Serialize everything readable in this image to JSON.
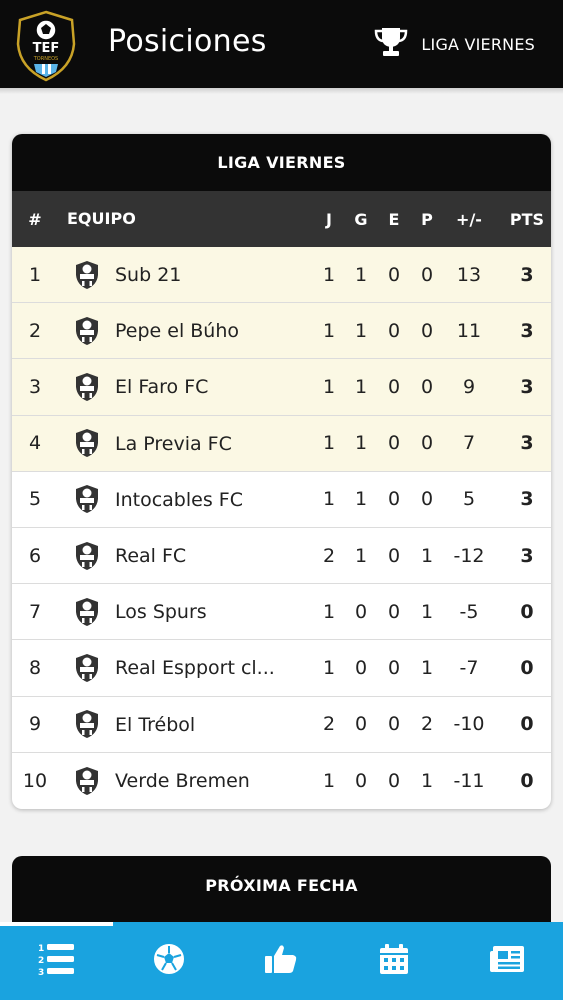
{
  "header": {
    "title": "Posiciones",
    "league_label": "LIGA VIERNES",
    "logo_text": "TEF",
    "logo_subtext": "TORNEOS"
  },
  "standings": {
    "title": "LIGA VIERNES",
    "columns": {
      "pos": "#",
      "team": "EQUIPO",
      "j": "J",
      "g": "G",
      "e": "E",
      "p": "P",
      "dif": "+/-",
      "pts": "PTS"
    },
    "rows": [
      {
        "pos": "1",
        "team": "Sub 21",
        "j": "1",
        "g": "1",
        "e": "0",
        "p": "0",
        "dif": "13",
        "pts": "3"
      },
      {
        "pos": "2",
        "team": "Pepe el Búho",
        "j": "1",
        "g": "1",
        "e": "0",
        "p": "0",
        "dif": "11",
        "pts": "3"
      },
      {
        "pos": "3",
        "team": "El Faro FC",
        "j": "1",
        "g": "1",
        "e": "0",
        "p": "0",
        "dif": "9",
        "pts": "3"
      },
      {
        "pos": "4",
        "team": "La Previa FC",
        "j": "1",
        "g": "1",
        "e": "0",
        "p": "0",
        "dif": "7",
        "pts": "3"
      },
      {
        "pos": "5",
        "team": "Intocables FC",
        "j": "1",
        "g": "1",
        "e": "0",
        "p": "0",
        "dif": "5",
        "pts": "3"
      },
      {
        "pos": "6",
        "team": "Real FC",
        "j": "2",
        "g": "1",
        "e": "0",
        "p": "1",
        "dif": "-12",
        "pts": "3"
      },
      {
        "pos": "7",
        "team": "Los Spurs",
        "j": "1",
        "g": "0",
        "e": "0",
        "p": "1",
        "dif": "-5",
        "pts": "0"
      },
      {
        "pos": "8",
        "team": "Real Espport cl...",
        "j": "1",
        "g": "0",
        "e": "0",
        "p": "1",
        "dif": "-7",
        "pts": "0"
      },
      {
        "pos": "9",
        "team": "El Trébol",
        "j": "2",
        "g": "0",
        "e": "0",
        "p": "2",
        "dif": "-10",
        "pts": "0"
      },
      {
        "pos": "10",
        "team": "Verde Bremen",
        "j": "1",
        "g": "0",
        "e": "0",
        "p": "1",
        "dif": "-11",
        "pts": "0"
      }
    ]
  },
  "next_date": {
    "title": "PRÓXIMA FECHA"
  },
  "bottom_nav": {
    "items": [
      {
        "icon": "standings-list-icon",
        "active": true
      },
      {
        "icon": "soccer-ball-icon",
        "active": false
      },
      {
        "icon": "thumbs-up-icon",
        "active": false
      },
      {
        "icon": "calendar-icon",
        "active": false
      },
      {
        "icon": "news-icon",
        "active": false
      }
    ]
  },
  "colors": {
    "header_bg": "#0b0b0b",
    "table_head_bg": "#333333",
    "highlight_row": "#fbf8e4",
    "nav_bg": "#1aa3df"
  }
}
